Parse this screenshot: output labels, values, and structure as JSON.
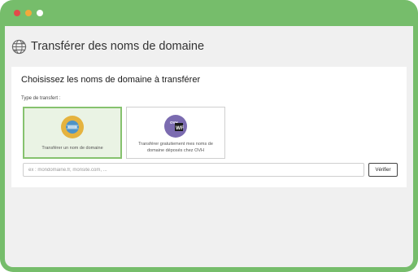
{
  "window": {
    "controls": [
      "close",
      "minimize",
      "fullscreen"
    ]
  },
  "header": {
    "title": "Transférer des noms de domaine",
    "icon": "globe-transfer-icon"
  },
  "card": {
    "title": "Choisissez les noms de domaine à transférer",
    "type_label": "Type de transfert :",
    "options": [
      {
        "label": "Transférer un nom de domaine",
        "icon": "domain-transfer-icon",
        "selected": true
      },
      {
        "label": "Transférer gratuitement mes noms de domaine déposés chez OVH",
        "icon": "ovh-logo-icon",
        "icon_text": "OVH",
        "icon_badge": "WF",
        "selected": false
      }
    ],
    "input": {
      "value": "",
      "placeholder": "ex : mondomaine.fr, monsite.com, ..."
    },
    "verify_button": "Vérifier"
  },
  "colors": {
    "frame": "#76bd6b",
    "selected_border": "#86c26e",
    "selected_bg": "#eaf3e4",
    "ovh_icon_bg": "#7b6bb0"
  }
}
